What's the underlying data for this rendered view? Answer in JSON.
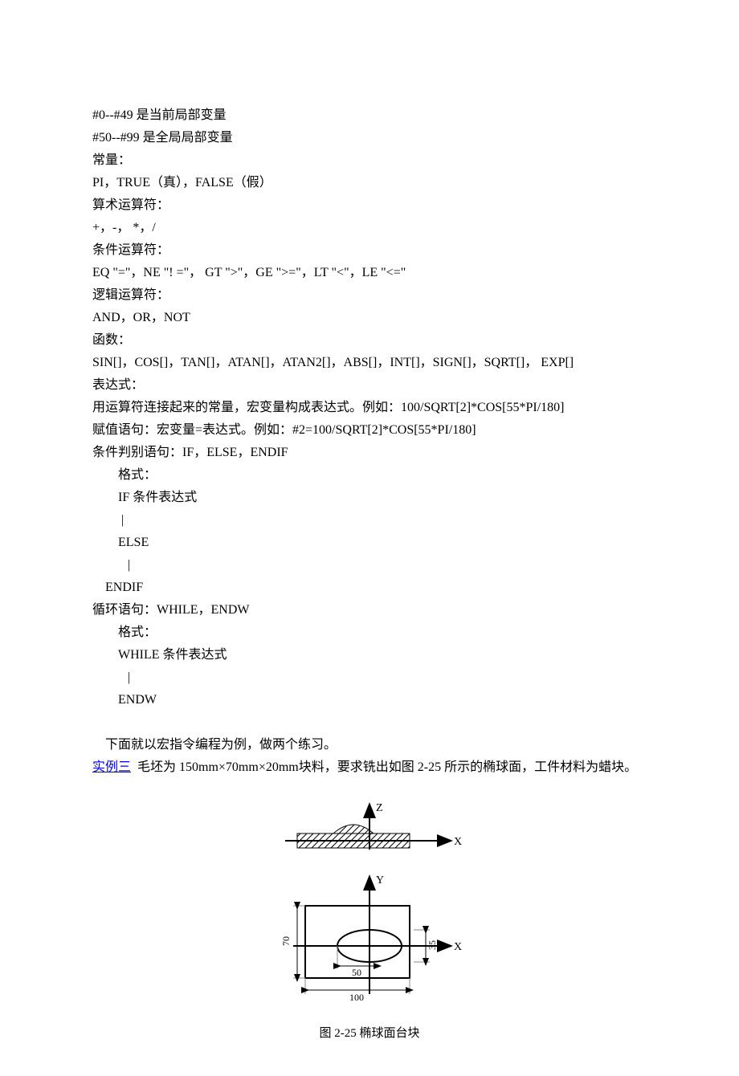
{
  "lines": {
    "l1": "#0--#49 是当前局部变量",
    "l2": "#50--#99 是全局局部变量",
    "l3": "常量：",
    "l4": "PI，TRUE（真），FALSE（假）",
    "l5": "算术运算符：",
    "l6": "+，-， *，/",
    "l7": "条件运算符：",
    "l8": "EQ \"=\"，NE \"! =\"， GT \">\"，GE \">=\"，LT \"<\"，LE \"<=\"",
    "l9": "逻辑运算符：",
    "l10": "AND，OR，NOT",
    "l11": "函数：",
    "l12": "SIN[]，COS[]，TAN[]，ATAN[]，ATAN2[]，ABS[]，INT[]，SIGN[]，SQRT[]， EXP[]",
    "l13": "表达式：",
    "l14": "用运算符连接起来的常量，宏变量构成表达式。例如：100/SQRT[2]*COS[55*PI/180]",
    "l15": "赋值语句：宏变量=表达式。例如：#2=100/SQRT[2]*COS[55*PI/180]",
    "l16": "条件判别语句：IF，ELSE，ENDIF",
    "l17": "格式：",
    "l18": "IF 条件表达式",
    "l19": " |",
    "l20": "ELSE",
    "l21": "   |",
    "l22": "ENDIF",
    "l23": "循环语句：WHILE，ENDW",
    "l24": "格式：",
    "l25": "WHILE 条件表达式",
    "l26": "   |",
    "l27": "ENDW",
    "l28": "    下面就以宏指令编程为例，做两个练习。",
    "link": "实例三",
    "l29": "  毛坯为 150mm×70mm×20mm块料，要求铣出如图 2-25 所示的椭球面，工件材料为蜡块。"
  },
  "diagram": {
    "caption": "图 2-25  椭球面台块",
    "dim50": "50",
    "dim70": "70",
    "dim100": "100",
    "dim35": "35",
    "axisZ": "Z",
    "axisX": "X",
    "axisY": "Y"
  }
}
